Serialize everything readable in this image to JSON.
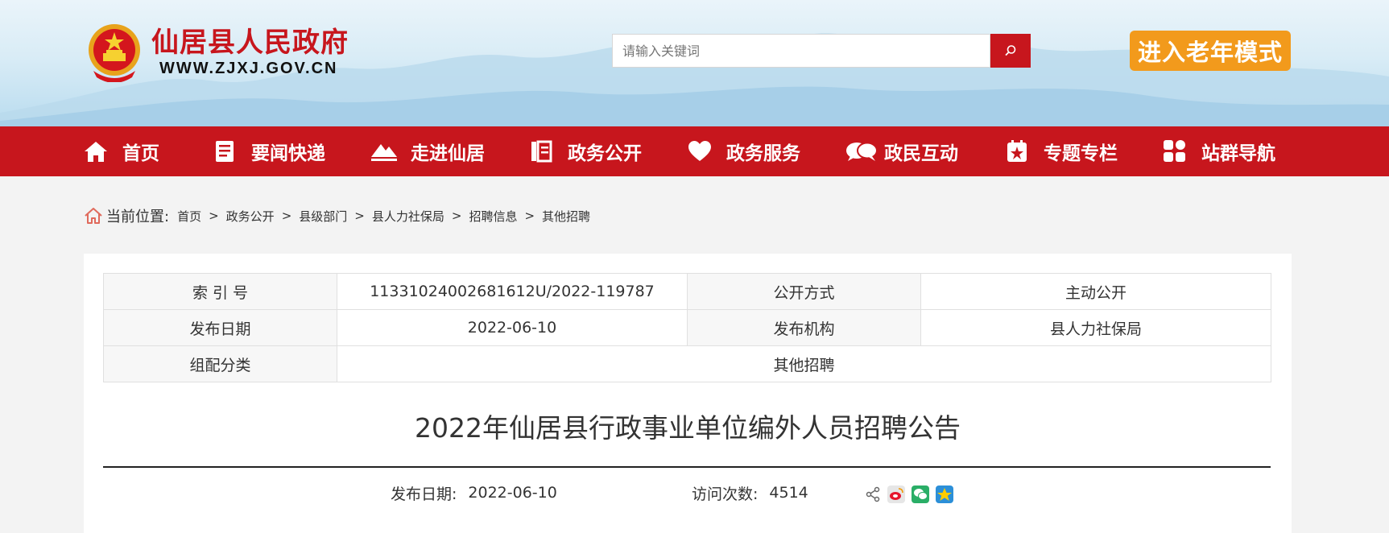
{
  "site": {
    "name": "仙居县人民政府",
    "url": "WWW.ZJXJ.GOV.CN",
    "brand_color": "#c7161d",
    "accent_color": "#f29a1c"
  },
  "search": {
    "placeholder": "请输入关键词",
    "icon": "search-icon"
  },
  "elder_mode_label": "进入老年模式",
  "nav": [
    {
      "label": "首页",
      "icon": "home-icon"
    },
    {
      "label": "要闻快递",
      "icon": "news-icon"
    },
    {
      "label": "走进仙居",
      "icon": "mountain-icon"
    },
    {
      "label": "政务公开",
      "icon": "document-icon"
    },
    {
      "label": "政务服务",
      "icon": "heart-icon"
    },
    {
      "label": "政民互动",
      "icon": "chat-icon"
    },
    {
      "label": "专题专栏",
      "icon": "star-calendar-icon"
    },
    {
      "label": "站群导航",
      "icon": "grid-icon"
    }
  ],
  "breadcrumb": {
    "label": "当前位置:",
    "items": [
      "首页",
      "政务公开",
      "县级部门",
      "县人力社保局",
      "招聘信息",
      "其他招聘"
    ]
  },
  "meta": {
    "index_label": "索 引 号",
    "index_value": "11331024002681612U/2022-119787",
    "open_label": "公开方式",
    "open_value": "主动公开",
    "date_label": "发布日期",
    "date_value": "2022-06-10",
    "org_label": "发布机构",
    "org_value": "县人力社保局",
    "category_label": "组配分类",
    "category_value": "其他招聘"
  },
  "article": {
    "title": "2022年仙居县行政事业单位编外人员招聘公告",
    "date_label": "发布日期:",
    "date_value": "2022-06-10",
    "visits_label": "访问次数:",
    "visits_value": "4514",
    "share_icons": [
      "share-icon",
      "weibo-icon",
      "wechat-icon",
      "qzone-icon"
    ]
  }
}
